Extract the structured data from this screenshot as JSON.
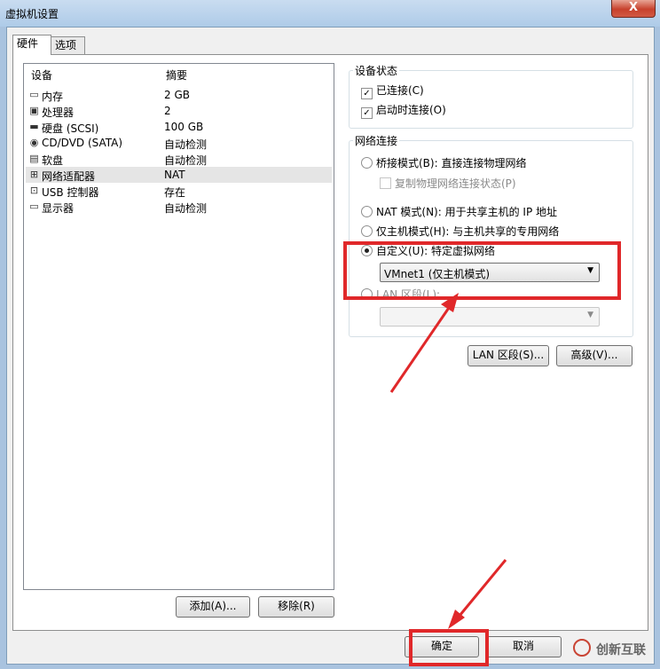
{
  "window": {
    "title": "虚拟机设置",
    "close_label": "X"
  },
  "tabs": [
    {
      "label": "硬件",
      "active": true
    },
    {
      "label": "选项",
      "active": false
    }
  ],
  "device_list": {
    "headers": {
      "device": "设备",
      "summary": "摘要"
    },
    "rows": [
      {
        "icon": "memory-icon",
        "name": "内存",
        "summary": "2 GB"
      },
      {
        "icon": "processor-icon",
        "name": "处理器",
        "summary": "2"
      },
      {
        "icon": "harddisk-icon",
        "name": "硬盘 (SCSI)",
        "summary": "100 GB"
      },
      {
        "icon": "cd-dvd-icon",
        "name": "CD/DVD (SATA)",
        "summary": "自动检测"
      },
      {
        "icon": "floppy-icon",
        "name": "软盘",
        "summary": "自动检测"
      },
      {
        "icon": "network-adapter-icon",
        "name": "网络适配器",
        "summary": "NAT",
        "selected": true
      },
      {
        "icon": "usb-icon",
        "name": "USB 控制器",
        "summary": "存在"
      },
      {
        "icon": "display-icon",
        "name": "显示器",
        "summary": "自动检测"
      }
    ]
  },
  "buttons": {
    "add": "添加(A)...",
    "remove": "移除(R)",
    "lan_segments": "LAN 区段(S)...",
    "advanced": "高级(V)...",
    "ok": "确定",
    "cancel": "取消"
  },
  "device_status": {
    "label": "设备状态",
    "connected": "已连接(C)",
    "connect_on_power_on": "启动时连接(O)"
  },
  "network": {
    "label": "网络连接",
    "bridged": "桥接模式(B): 直接连接物理网络",
    "replicate": "复制物理网络连接状态(P)",
    "nat": "NAT 模式(N): 用于共享主机的 IP 地址",
    "host_only": "仅主机模式(H): 与主机共享的专用网络",
    "custom": "自定义(U): 特定虚拟网络",
    "custom_selected": "VMnet1 (仅主机模式)",
    "lan_segment": "LAN 区段(L):",
    "lan_segment_value": ""
  },
  "watermark": "创新互联",
  "colors": {
    "highlight": "#e0282a",
    "arrow": "#e0282a"
  }
}
